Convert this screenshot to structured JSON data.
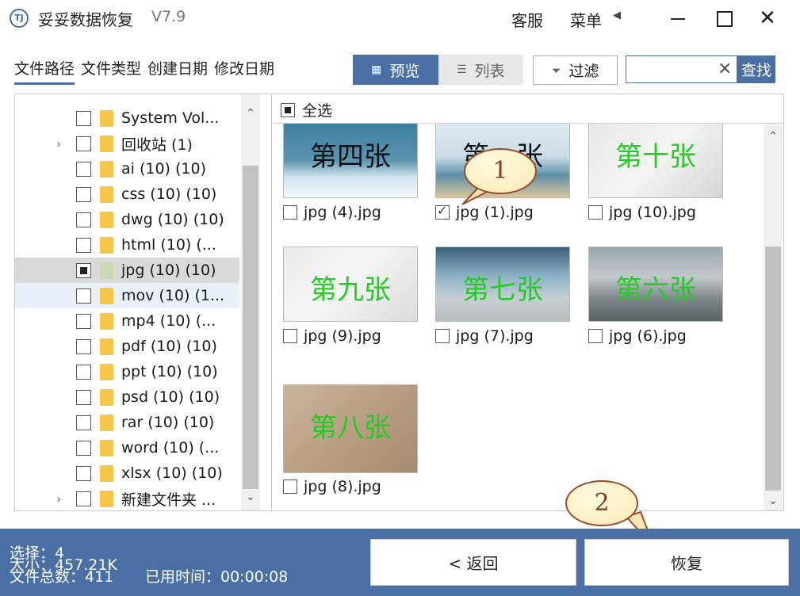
{
  "titlebar": {
    "logo_text": "TJ",
    "title": "妥妥数据恢复",
    "version": "V7.9",
    "service": "客服",
    "menu": "菜单",
    "menu_arrow": "◀",
    "close": "✕"
  },
  "tabs": [
    {
      "label": "文件路径",
      "active": true
    },
    {
      "label": "文件类型",
      "active": false
    },
    {
      "label": "创建日期",
      "active": false
    },
    {
      "label": "修改日期",
      "active": false
    }
  ],
  "toolbar": {
    "preview_label": "预览",
    "list_label": "列表",
    "filter_label": "过滤",
    "search_placeholder": "",
    "search_clear": "×",
    "search_label": "查找"
  },
  "tree": {
    "items": [
      {
        "label": "System Vol...",
        "expander": ""
      },
      {
        "label": "回收站  (1)",
        "expander": "›"
      },
      {
        "label": "ai (10)  (10)",
        "expander": ""
      },
      {
        "label": "css (10)  (10)",
        "expander": ""
      },
      {
        "label": "dwg (10)  (10)",
        "expander": ""
      },
      {
        "label": "html (10)  (...",
        "expander": ""
      },
      {
        "label": "jpg (10)  (10)",
        "expander": ""
      },
      {
        "label": "mov (10)  (1...",
        "expander": ""
      },
      {
        "label": "mp4 (10)  (...",
        "expander": ""
      },
      {
        "label": "pdf (10)  (10)",
        "expander": ""
      },
      {
        "label": "ppt (10)  (10)",
        "expander": ""
      },
      {
        "label": "psd (10)  (10)",
        "expander": ""
      },
      {
        "label": "rar (10)  (10)",
        "expander": ""
      },
      {
        "label": "word (10)  (...",
        "expander": ""
      },
      {
        "label": "xlsx (10)  (10)",
        "expander": ""
      },
      {
        "label": "新建文件夹  ...",
        "expander": "›"
      }
    ],
    "scroll_up": "⌃",
    "scroll_down": "⌄"
  },
  "grid": {
    "select_all": "全选",
    "items": [
      {
        "caption": "jpg (4).jpg",
        "thumb_text": "第四张",
        "checked": false
      },
      {
        "caption": "jpg (1).jpg",
        "thumb_text": "第一张",
        "checked": true
      },
      {
        "caption": "jpg (10).jpg",
        "thumb_text": "第十张",
        "checked": false
      },
      {
        "caption": "jpg (9).jpg",
        "thumb_text": "第九张",
        "checked": false
      },
      {
        "caption": "jpg (7).jpg",
        "thumb_text": "第七张",
        "checked": false
      },
      {
        "caption": "jpg (6).jpg",
        "thumb_text": "第六张",
        "checked": false
      },
      {
        "caption": "jpg (8).jpg",
        "thumb_text": "第八张",
        "checked": false
      }
    ],
    "scroll_up": "⌃",
    "scroll_down": "⌄"
  },
  "callouts": {
    "one": "1",
    "two": "2"
  },
  "status": {
    "selected": "选择：4",
    "size": "大小：457.21K",
    "total": "文件总数：411",
    "elapsed": "已用时间：00:00:08"
  },
  "buttons": {
    "back": "< 返回",
    "recover": "恢复"
  },
  "colors": {
    "accent": "#4a6fa5",
    "thumb_green_text": "#22cc22",
    "thumb_black_text": "#111111"
  }
}
